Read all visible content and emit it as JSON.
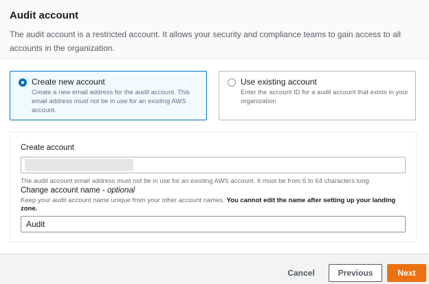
{
  "header": {
    "title": "Audit account",
    "description": "The audit account is a restricted account. It allows your security and compliance teams to gain access to all accounts in the organization."
  },
  "options": {
    "new_account": {
      "label": "Create new account",
      "description": "Create a new email address for the audit account. This email address must not be in use for an existing AWS account.",
      "selected": true
    },
    "existing_account": {
      "label": "Use existing account",
      "description": "Enter the account ID for a audit account that exists in your organization",
      "selected": false
    }
  },
  "form": {
    "create_account_label": "Create account",
    "email_value": "",
    "email_hint": "The audit account email address must not be in use for an existing AWS account. It must be from 6 to 64 characters long.",
    "name_label": "Change account name - ",
    "name_label_optional": "optional",
    "name_hint": "Keep your audit account name unique from your other account names. ",
    "name_hint_bold": "You cannot edit the name after setting up your landing zone.",
    "name_value": "Audit"
  },
  "footer": {
    "cancel_label": "Cancel",
    "previous_label": "Previous",
    "next_label": "Next"
  },
  "colors": {
    "accent": "#0073bb",
    "primary_button": "#ec7211"
  }
}
